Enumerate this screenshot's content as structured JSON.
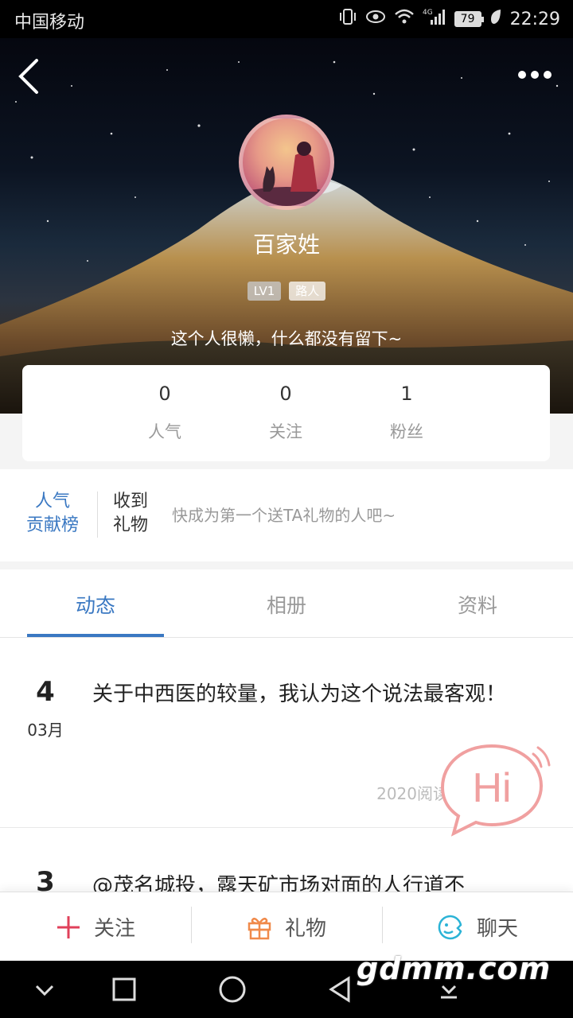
{
  "status_bar": {
    "carrier": "中国移动",
    "battery": "79",
    "time": "22:29",
    "icons": [
      "vibrate-icon",
      "eye-icon",
      "wifi-icon",
      "signal-4g-icon",
      "battery-icon",
      "leaf-icon"
    ]
  },
  "profile": {
    "username": "百家姓",
    "level": "LV1",
    "tag": "路人",
    "bio": "这个人很懒，什么都没有留下~"
  },
  "stats": [
    {
      "value": "0",
      "label": "人气"
    },
    {
      "value": "0",
      "label": "关注"
    },
    {
      "value": "1",
      "label": "粉丝"
    }
  ],
  "gift": {
    "rank_line1": "人气",
    "rank_line2": "贡献榜",
    "received_line1": "收到",
    "received_line2": "礼物",
    "hint": "快成为第一个送TA礼物的人吧~"
  },
  "tabs": [
    {
      "label": "动态"
    },
    {
      "label": "相册"
    },
    {
      "label": "资料"
    }
  ],
  "posts": [
    {
      "day": "4",
      "month": "03月",
      "title": "关于中西医的较量，我认为这个说法最客观！",
      "reads": "2020阅读"
    },
    {
      "day": "3",
      "month": "",
      "title": "@茂名城投，露天矿市场对面的人行道不",
      "reads": ""
    }
  ],
  "hi_bubble": {
    "text": "Hi"
  },
  "actions": [
    {
      "label": "关注",
      "icon": "plus-icon"
    },
    {
      "label": "礼物",
      "icon": "gift-icon"
    },
    {
      "label": "聊天",
      "icon": "chat-icon"
    }
  ],
  "watermark": "gdmm.com",
  "colors": {
    "accent": "#3a78c2",
    "follow": "#e0405a",
    "gift": "#f08a4b",
    "chat": "#2bb3d6",
    "hi": "#f0a0a0"
  }
}
